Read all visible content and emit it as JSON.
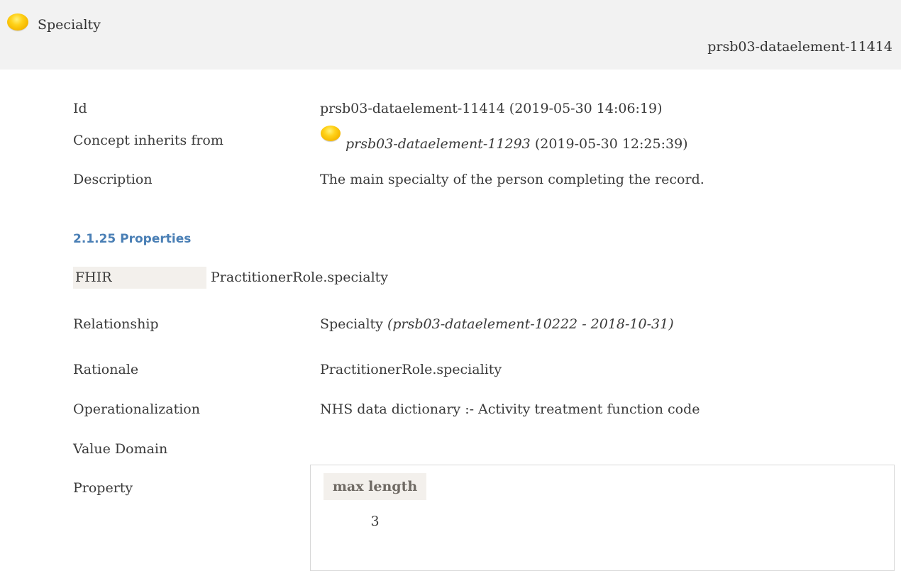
{
  "header": {
    "title": "Specialty",
    "id": "prsb03-dataelement-11414"
  },
  "details": {
    "id_label": "Id",
    "id_value": "prsb03-dataelement-11414 (2019-05-30 14:06:19)",
    "inherits_label": "Concept inherits from",
    "inherits_id": "prsb03-dataelement-11293",
    "inherits_date": "(2019-05-30 12:25:39)",
    "description_label": "Description",
    "description_value": "The main specialty of the person completing the record."
  },
  "properties": {
    "section_title": "2.1.25 Properties",
    "fhir_label": "FHIR",
    "fhir_value": "PractitionerRole.specialty",
    "relationship_label": "Relationship",
    "relationship_name": "Specialty",
    "relationship_ref": "(prsb03-dataelement-10222 - 2018-10-31)",
    "rationale_label": "Rationale",
    "rationale_value": "PractitionerRole.speciality",
    "operationalization_label": "Operationalization",
    "operationalization_value": "NHS data dictionary :- Activity treatment function code",
    "value_domain_label": "Value Domain",
    "property_label": "Property",
    "property_table": {
      "header": "max length",
      "value": "3"
    }
  },
  "icons": {
    "header_status": "status-orb-icon",
    "inherits_status": "status-orb-icon"
  }
}
